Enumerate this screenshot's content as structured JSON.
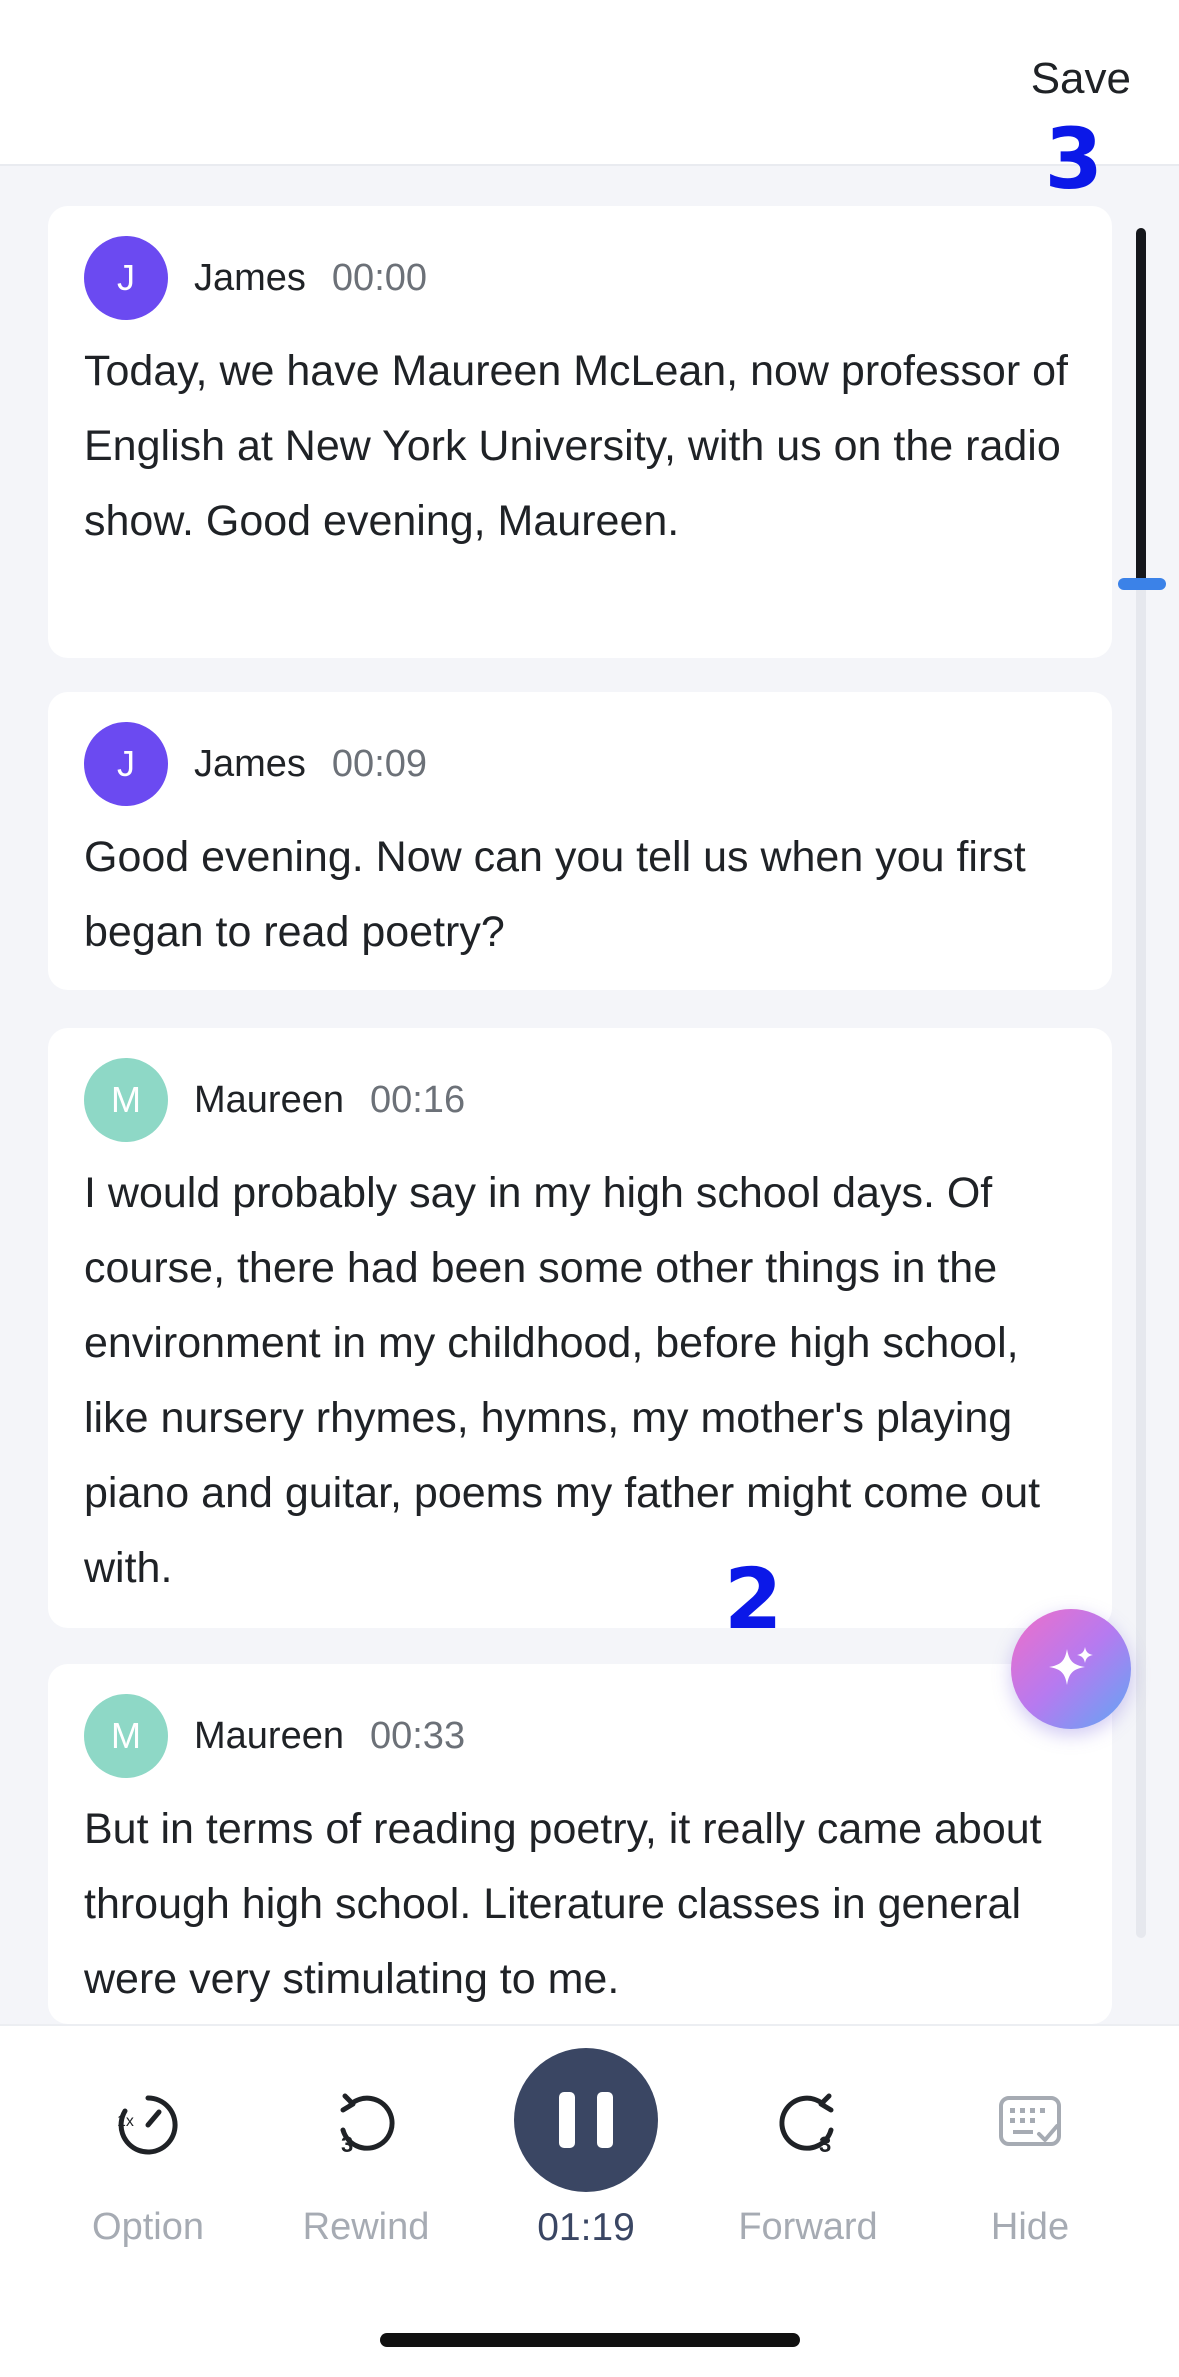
{
  "header": {
    "save_label": "Save"
  },
  "annotations": {
    "top": "3",
    "middle": "2"
  },
  "transcript": [
    {
      "initial": "J",
      "speaker": "James",
      "time": "00:00",
      "color": "#6b4af1",
      "text": "Today, we have Maureen McLean, now professor of English at New York University, with us on the radio show. Good evening, Maureen."
    },
    {
      "initial": "J",
      "speaker": "James",
      "time": "00:09",
      "color": "#6b4af1",
      "text": "Good evening. Now can you tell us when you first began to read poetry?"
    },
    {
      "initial": "M",
      "speaker": "Maureen",
      "time": "00:16",
      "color": "#8ed8c6",
      "text": "I would probably say in my high school days. Of course, there had been some other things in the environment in my childhood, before high school, like nursery rhymes, hymns, my mother's playing piano and guitar, poems my father might come out with."
    },
    {
      "initial": "M",
      "speaker": "Maureen",
      "time": "00:33",
      "color": "#8ed8c6",
      "text": "But in terms of reading poetry, it really came about through high school. Literature classes in general were very stimulating to me."
    }
  ],
  "player": {
    "option_label": "Option",
    "option_badge": "1x",
    "rewind_label": "Rewind",
    "rewind_badge": "3",
    "current_time": "01:19",
    "forward_label": "Forward",
    "forward_badge": "3",
    "hide_label": "Hide"
  },
  "icons": {
    "option": "speed-icon",
    "rewind": "rewind-icon",
    "play": "pause-icon",
    "forward": "forward-icon",
    "hide": "keyboard-hide-icon",
    "fab": "sparkle-icon"
  }
}
